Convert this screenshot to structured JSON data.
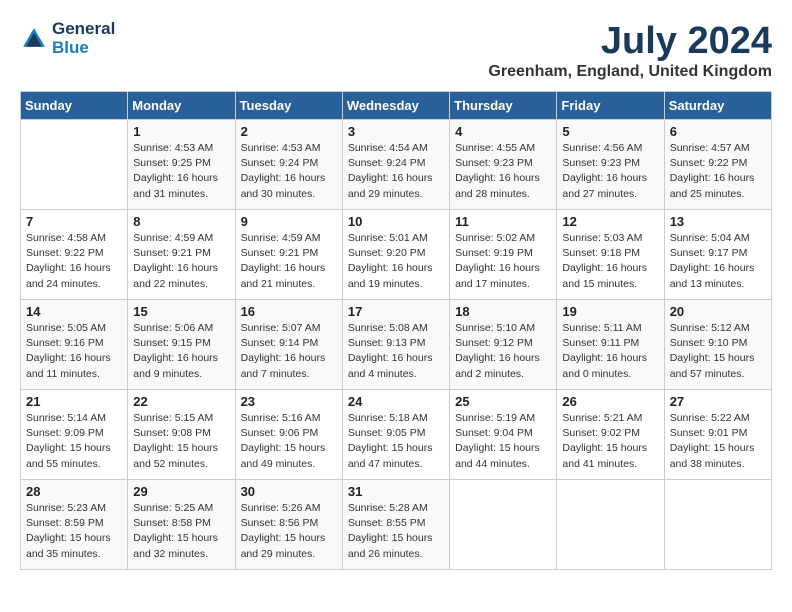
{
  "logo": {
    "line1": "General",
    "line2": "Blue"
  },
  "title": "July 2024",
  "location": "Greenham, England, United Kingdom",
  "days_of_week": [
    "Sunday",
    "Monday",
    "Tuesday",
    "Wednesday",
    "Thursday",
    "Friday",
    "Saturday"
  ],
  "weeks": [
    [
      {
        "day": "",
        "info": ""
      },
      {
        "day": "1",
        "info": "Sunrise: 4:53 AM\nSunset: 9:25 PM\nDaylight: 16 hours\nand 31 minutes."
      },
      {
        "day": "2",
        "info": "Sunrise: 4:53 AM\nSunset: 9:24 PM\nDaylight: 16 hours\nand 30 minutes."
      },
      {
        "day": "3",
        "info": "Sunrise: 4:54 AM\nSunset: 9:24 PM\nDaylight: 16 hours\nand 29 minutes."
      },
      {
        "day": "4",
        "info": "Sunrise: 4:55 AM\nSunset: 9:23 PM\nDaylight: 16 hours\nand 28 minutes."
      },
      {
        "day": "5",
        "info": "Sunrise: 4:56 AM\nSunset: 9:23 PM\nDaylight: 16 hours\nand 27 minutes."
      },
      {
        "day": "6",
        "info": "Sunrise: 4:57 AM\nSunset: 9:22 PM\nDaylight: 16 hours\nand 25 minutes."
      }
    ],
    [
      {
        "day": "7",
        "info": "Sunrise: 4:58 AM\nSunset: 9:22 PM\nDaylight: 16 hours\nand 24 minutes."
      },
      {
        "day": "8",
        "info": "Sunrise: 4:59 AM\nSunset: 9:21 PM\nDaylight: 16 hours\nand 22 minutes."
      },
      {
        "day": "9",
        "info": "Sunrise: 4:59 AM\nSunset: 9:21 PM\nDaylight: 16 hours\nand 21 minutes."
      },
      {
        "day": "10",
        "info": "Sunrise: 5:01 AM\nSunset: 9:20 PM\nDaylight: 16 hours\nand 19 minutes."
      },
      {
        "day": "11",
        "info": "Sunrise: 5:02 AM\nSunset: 9:19 PM\nDaylight: 16 hours\nand 17 minutes."
      },
      {
        "day": "12",
        "info": "Sunrise: 5:03 AM\nSunset: 9:18 PM\nDaylight: 16 hours\nand 15 minutes."
      },
      {
        "day": "13",
        "info": "Sunrise: 5:04 AM\nSunset: 9:17 PM\nDaylight: 16 hours\nand 13 minutes."
      }
    ],
    [
      {
        "day": "14",
        "info": "Sunrise: 5:05 AM\nSunset: 9:16 PM\nDaylight: 16 hours\nand 11 minutes."
      },
      {
        "day": "15",
        "info": "Sunrise: 5:06 AM\nSunset: 9:15 PM\nDaylight: 16 hours\nand 9 minutes."
      },
      {
        "day": "16",
        "info": "Sunrise: 5:07 AM\nSunset: 9:14 PM\nDaylight: 16 hours\nand 7 minutes."
      },
      {
        "day": "17",
        "info": "Sunrise: 5:08 AM\nSunset: 9:13 PM\nDaylight: 16 hours\nand 4 minutes."
      },
      {
        "day": "18",
        "info": "Sunrise: 5:10 AM\nSunset: 9:12 PM\nDaylight: 16 hours\nand 2 minutes."
      },
      {
        "day": "19",
        "info": "Sunrise: 5:11 AM\nSunset: 9:11 PM\nDaylight: 16 hours\nand 0 minutes."
      },
      {
        "day": "20",
        "info": "Sunrise: 5:12 AM\nSunset: 9:10 PM\nDaylight: 15 hours\nand 57 minutes."
      }
    ],
    [
      {
        "day": "21",
        "info": "Sunrise: 5:14 AM\nSunset: 9:09 PM\nDaylight: 15 hours\nand 55 minutes."
      },
      {
        "day": "22",
        "info": "Sunrise: 5:15 AM\nSunset: 9:08 PM\nDaylight: 15 hours\nand 52 minutes."
      },
      {
        "day": "23",
        "info": "Sunrise: 5:16 AM\nSunset: 9:06 PM\nDaylight: 15 hours\nand 49 minutes."
      },
      {
        "day": "24",
        "info": "Sunrise: 5:18 AM\nSunset: 9:05 PM\nDaylight: 15 hours\nand 47 minutes."
      },
      {
        "day": "25",
        "info": "Sunrise: 5:19 AM\nSunset: 9:04 PM\nDaylight: 15 hours\nand 44 minutes."
      },
      {
        "day": "26",
        "info": "Sunrise: 5:21 AM\nSunset: 9:02 PM\nDaylight: 15 hours\nand 41 minutes."
      },
      {
        "day": "27",
        "info": "Sunrise: 5:22 AM\nSunset: 9:01 PM\nDaylight: 15 hours\nand 38 minutes."
      }
    ],
    [
      {
        "day": "28",
        "info": "Sunrise: 5:23 AM\nSunset: 8:59 PM\nDaylight: 15 hours\nand 35 minutes."
      },
      {
        "day": "29",
        "info": "Sunrise: 5:25 AM\nSunset: 8:58 PM\nDaylight: 15 hours\nand 32 minutes."
      },
      {
        "day": "30",
        "info": "Sunrise: 5:26 AM\nSunset: 8:56 PM\nDaylight: 15 hours\nand 29 minutes."
      },
      {
        "day": "31",
        "info": "Sunrise: 5:28 AM\nSunset: 8:55 PM\nDaylight: 15 hours\nand 26 minutes."
      },
      {
        "day": "",
        "info": ""
      },
      {
        "day": "",
        "info": ""
      },
      {
        "day": "",
        "info": ""
      }
    ]
  ]
}
